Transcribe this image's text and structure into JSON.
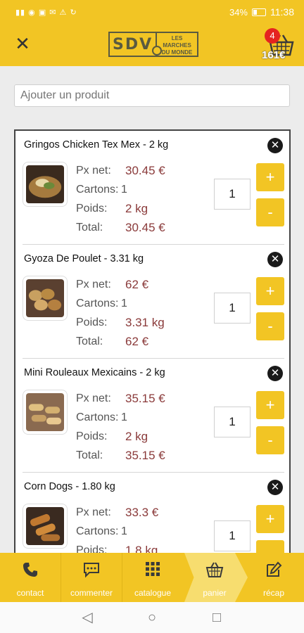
{
  "status_bar": {
    "left_icons": "▮▮ ◉ ▣ ✉ ⚠ ↻",
    "battery": "34%",
    "time": "11:38"
  },
  "header": {
    "logo_main": "SDV",
    "logo_sub": "LES MARCHES DU MONDE",
    "cart_count": "4",
    "cart_total": "161€"
  },
  "search": {
    "placeholder": "Ajouter un produit"
  },
  "labels": {
    "price": "Px net:",
    "cartons": "Cartons:",
    "weight": "Poids:",
    "total": "Total:"
  },
  "items": [
    {
      "name": "Gringos Chicken Tex Mex - 2 kg",
      "price": "30.45 €",
      "cartons": "1",
      "weight": "2 kg",
      "total": "30.45 €",
      "qty": "1",
      "thumb_color": "#a57a3e"
    },
    {
      "name": "Gyoza De Poulet - 3.31 kg",
      "price": "62 €",
      "cartons": "1",
      "weight": "3.31 kg",
      "total": "62 €",
      "qty": "1",
      "thumb_color": "#b98a43"
    },
    {
      "name": "Mini Rouleaux Mexicains - 2 kg",
      "price": "35.15 €",
      "cartons": "1",
      "weight": "2 kg",
      "total": "35.15 €",
      "qty": "1",
      "thumb_color": "#c7a065"
    },
    {
      "name": "Corn Dogs - 1.80 kg",
      "price": "33.3 €",
      "cartons": "1",
      "weight": "1.8 kg",
      "total": "",
      "qty": "1",
      "thumb_color": "#b07030"
    }
  ],
  "buttons": {
    "plus": "+",
    "minus": "-",
    "remove": "✕"
  },
  "nav": [
    {
      "label": "contact",
      "icon": "phone-icon"
    },
    {
      "label": "commenter",
      "icon": "comment-icon"
    },
    {
      "label": "catalogue",
      "icon": "grid-icon"
    },
    {
      "label": "panier",
      "icon": "basket-icon"
    },
    {
      "label": "récap",
      "icon": "edit-icon"
    }
  ],
  "colors": {
    "accent": "#f2c524",
    "price": "#8a3a3a",
    "badge": "#e52320"
  }
}
